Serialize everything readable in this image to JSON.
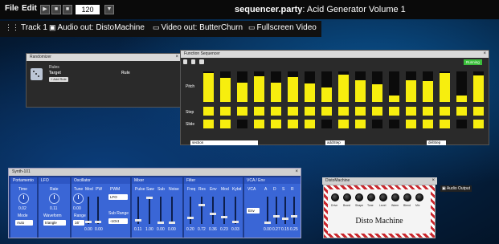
{
  "menubar": {
    "file": "File",
    "edit": "Edit",
    "bpm": "120",
    "title_site": "sequencer.party",
    "title_rest": ": Acid Generator Volume 1"
  },
  "tabs": [
    {
      "label": "Track 1",
      "icon": "sliders-icon"
    },
    {
      "label": "Audio out: DistoMachine",
      "icon": "speaker-icon"
    },
    {
      "label": "Video out: ButterChurn",
      "icon": "monitor-icon"
    },
    {
      "label": "Fullscreen Video",
      "icon": "monitor-icon"
    }
  ],
  "randomizer": {
    "title": "Randomizer",
    "rules": "Rules",
    "target": "Target",
    "rule": "Rule",
    "add_rule": "+ Add Rule"
  },
  "sequencer": {
    "title": "Function Sequencer",
    "status": "Running",
    "rows": [
      "Pitch",
      "Step",
      "Slide"
    ],
    "pitch_levels": [
      0.95,
      0.78,
      0.62,
      0.85,
      0.62,
      0.82,
      0.6,
      0.48,
      0.9,
      0.72,
      0.58,
      0.22,
      0.72,
      0.68,
      0.95,
      0.2,
      0.88
    ],
    "step_on": [
      true,
      true,
      true,
      true,
      true,
      true,
      true,
      true,
      true,
      true,
      true,
      true,
      true,
      true,
      true,
      true,
      true
    ],
    "slide_on": [
      true,
      true,
      false,
      true,
      true,
      true,
      true,
      false,
      true,
      true,
      false,
      false,
      true,
      true,
      true,
      false,
      true
    ],
    "controls": [
      "section",
      "addStep",
      "delStep"
    ],
    "colors": {
      "on": "#f7ee0e",
      "off": "#0b0b0b"
    }
  },
  "synth": {
    "title": "Synth-101",
    "sections": {
      "portamento": {
        "header": "Portamento",
        "time_label": "Time",
        "time_value": "0.02",
        "mode_label": "Mode",
        "mode_value": "Auto"
      },
      "lfo": {
        "header": "LFO",
        "rate_label": "Rate",
        "rate_value": "0.11",
        "waveform_label": "Waveform",
        "waveform_value": "triangle"
      },
      "oscillator": {
        "header": "Oscillator",
        "tune_label": "Tune",
        "mod_label": "Mod",
        "pw_label": "PW",
        "pwm_label": "PWM",
        "pwm_value": "LFO",
        "tune_value": "0.00",
        "range_label": "Range",
        "range_value": "16'",
        "sub_range_label": "Sub Range",
        "sub_range_value": "-1Oct",
        "mod_value": "0.00",
        "pw_value": "0.00"
      },
      "mixer": {
        "header": "Mixer",
        "labels": [
          "Pulse",
          "Saw",
          "Sub",
          "Noise"
        ],
        "values": [
          "0.11",
          "1.00",
          "0.00",
          "0.00"
        ],
        "levels": [
          0.11,
          1.0,
          0.0,
          0.0
        ]
      },
      "filter": {
        "header": "Filter",
        "labels": [
          "Freq",
          "Res",
          "Env",
          "Mod",
          "Kybd"
        ],
        "values": [
          "0.20",
          "0.72",
          "0.36",
          "0.23",
          "0.03"
        ],
        "levels": [
          0.2,
          0.72,
          0.36,
          0.23,
          0.03
        ]
      },
      "vca": {
        "header": "VCA / Env",
        "vca_label": "VCA",
        "vca_value": "Env",
        "labels": [
          "A",
          "D",
          "S",
          "R"
        ],
        "values": [
          "0.00",
          "0.27",
          "0.15",
          "0.25"
        ],
        "levels": [
          0.0,
          0.27,
          0.15,
          0.25
        ]
      }
    }
  },
  "disto": {
    "title": "DistoMachine",
    "knob_labels": [
      "Drive",
      "Boost",
      "Shape",
      "Tone",
      "Level",
      "Warm",
      "Blend",
      "Mix"
    ],
    "name": "Disto Machine",
    "audio_output": "Audio Output"
  }
}
